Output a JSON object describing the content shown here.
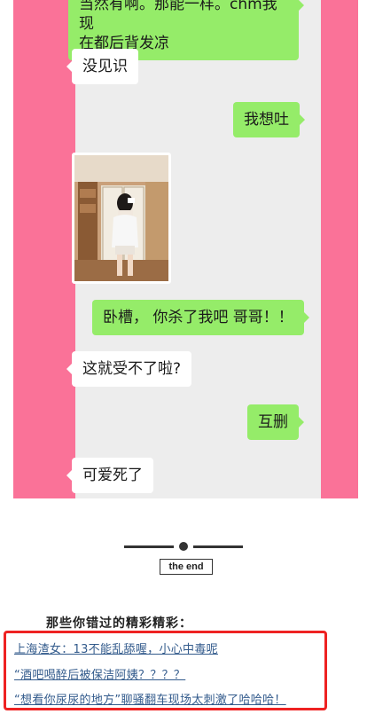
{
  "chat": {
    "messages": [
      {
        "side": "right",
        "text": "当然有啊。那能一样。chm我现在都后背发凉"
      },
      {
        "side": "left",
        "text": "没见识"
      },
      {
        "side": "right",
        "text": "我想吐"
      },
      {
        "side": "left",
        "type": "image",
        "description": "photo-message"
      },
      {
        "side": "right",
        "text": "卧槽， 你杀了我吧 哥哥！！"
      },
      {
        "side": "left",
        "text": "这就受不了啦?"
      },
      {
        "side": "right",
        "text": "互删"
      },
      {
        "side": "left",
        "text": "可爱死了"
      }
    ],
    "first_bubble_line1": "当然有啊。那能一样。chm我现",
    "first_bubble_line2": "在都后背发凉"
  },
  "end_label": "the end",
  "related": {
    "title": "那些你错过的精彩精彩：",
    "links": [
      "上海渣女：13不能乱舔喔，小心中毒呢",
      "“酒吧喝醉后被保洁阿姨？？？？",
      "“想看你尿尿的地方”聊骚翻车现场太刺激了哈哈哈！"
    ]
  },
  "colors": {
    "frame_pink": "#fa7298",
    "chat_bg": "#ededed",
    "sent_bubble": "#95ec69",
    "received_bubble": "#ffffff",
    "link": "#335b8c",
    "highlight": "#ee2222"
  }
}
